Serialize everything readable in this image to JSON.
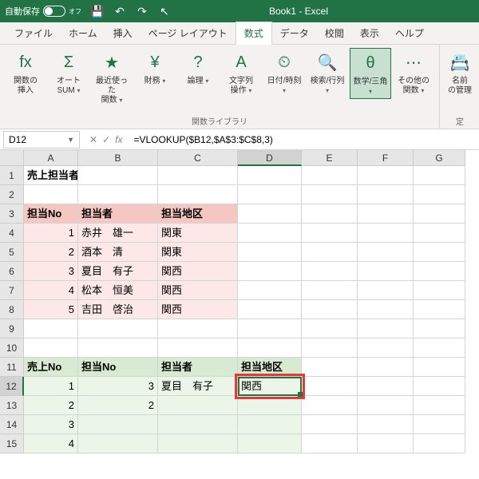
{
  "titlebar": {
    "autosave": "自動保存",
    "autosave_state": "オフ",
    "title": "Book1 - Excel"
  },
  "tabs": [
    "ファイル",
    "ホーム",
    "挿入",
    "ページ レイアウト",
    "数式",
    "データ",
    "校閲",
    "表示",
    "ヘルプ"
  ],
  "active_tab": 4,
  "ribbon": {
    "items": [
      {
        "label": "関数の\n挿入",
        "icon": "fx"
      },
      {
        "label": "オート\nSUM",
        "icon": "Σ",
        "arrow": true
      },
      {
        "label": "最近使った\n関数",
        "icon": "★",
        "arrow": true
      },
      {
        "label": "財務",
        "icon": "¥",
        "arrow": true
      },
      {
        "label": "論理",
        "icon": "?",
        "arrow": true
      },
      {
        "label": "文字列\n操作",
        "icon": "A",
        "arrow": true
      },
      {
        "label": "日付/時刻",
        "icon": "⏲",
        "arrow": true
      },
      {
        "label": "検索/行列",
        "icon": "🔍",
        "arrow": true
      },
      {
        "label": "数学/三角",
        "icon": "θ",
        "arrow": true,
        "active": true
      },
      {
        "label": "その他の\n関数",
        "icon": "⋯",
        "arrow": true
      },
      {
        "label": "名前\nの管理",
        "icon": "📇"
      }
    ],
    "group_label": "関数ライブラリ",
    "right_label": "定"
  },
  "name_box": "D12",
  "formula": "=VLOOKUP($B12,$A$3:$C$8,3)",
  "columns": [
    "A",
    "B",
    "C",
    "D",
    "E",
    "F",
    "G"
  ],
  "rows": [
    [
      "売上担当者一覧",
      "",
      "",
      "",
      "",
      "",
      ""
    ],
    [
      "",
      "",
      "",
      "",
      "",
      "",
      ""
    ],
    [
      "担当No",
      "担当者",
      "担当地区",
      "",
      "",
      "",
      ""
    ],
    [
      "1",
      "赤井　雄一",
      "関東",
      "",
      "",
      "",
      ""
    ],
    [
      "2",
      "酒本　清",
      "関東",
      "",
      "",
      "",
      ""
    ],
    [
      "3",
      "夏目　有子",
      "関西",
      "",
      "",
      "",
      ""
    ],
    [
      "4",
      "松本　恒美",
      "関西",
      "",
      "",
      "",
      ""
    ],
    [
      "5",
      "吉田　啓治",
      "関西",
      "",
      "",
      "",
      ""
    ],
    [
      "",
      "",
      "",
      "",
      "",
      "",
      ""
    ],
    [
      "",
      "",
      "",
      "",
      "",
      "",
      ""
    ],
    [
      "売上No",
      "担当No",
      "担当者",
      "担当地区",
      "",
      "",
      ""
    ],
    [
      "1",
      "3",
      "夏目　有子",
      "関西",
      "",
      "",
      ""
    ],
    [
      "2",
      "2",
      "",
      "",
      "",
      "",
      ""
    ],
    [
      "3",
      "",
      "",
      "",
      "",
      "",
      ""
    ],
    [
      "4",
      "",
      "",
      "",
      "",
      "",
      ""
    ]
  ]
}
